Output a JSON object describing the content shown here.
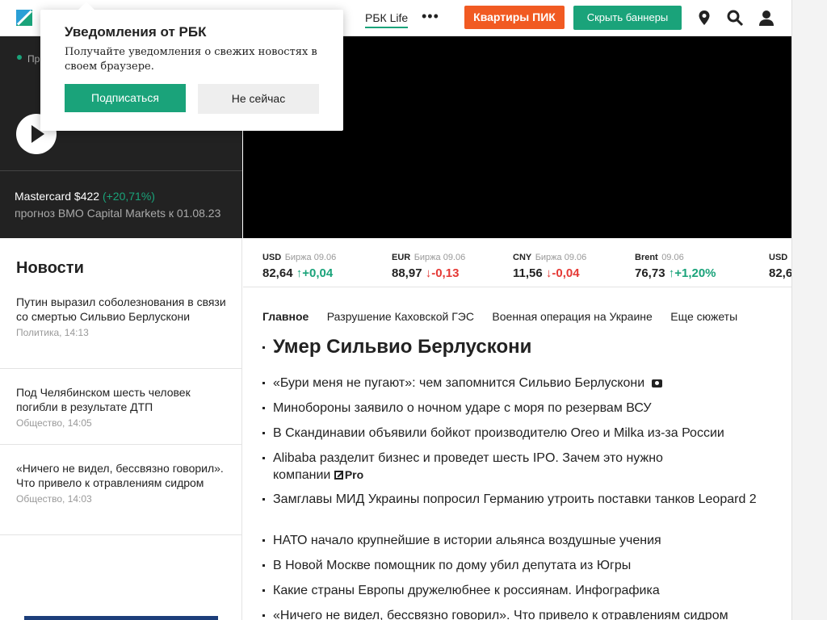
{
  "header": {
    "nav_partial": "и",
    "nav_life": "РБК Life",
    "nav_more": "•••",
    "pik_button": "Квартиры ПИК",
    "hide_banners_button": "Скрыть баннеры"
  },
  "icons": [
    "location-pin-icon",
    "search-icon",
    "user-icon",
    "camera-icon",
    "play-icon"
  ],
  "colors": {
    "accent_green": "#1aa37a",
    "pik_orange": "#f15a22",
    "down_red": "#e53935"
  },
  "promo": {
    "label": "Пр",
    "title": "Mastercard $422",
    "gain": "(+20,71%)",
    "subtitle": "прогноз BMO Capital Markets к 01.08.23"
  },
  "ticker": [
    {
      "cur": "USD",
      "src": "Биржа 09.06",
      "value": "82,64",
      "arrow": "↑",
      "change": "+0,04",
      "dir": "up"
    },
    {
      "cur": "EUR",
      "src": "Биржа 09.06",
      "value": "88,97",
      "arrow": "↓",
      "change": "-0,13",
      "dir": "down"
    },
    {
      "cur": "CNY",
      "src": "Биржа 09.06",
      "value": "11,56",
      "arrow": "↓",
      "change": "-0,04",
      "dir": "down"
    },
    {
      "cur": "Brent",
      "src": "09.06",
      "value": "76,73",
      "arrow": "↑",
      "change": "+1,20%",
      "dir": "up"
    },
    {
      "cur": "USD",
      "src": "",
      "value": "82,6",
      "arrow": "",
      "change": "",
      "dir": "up"
    }
  ],
  "news": {
    "heading": "Новости",
    "items": [
      {
        "title": "Путин выразил соболезнования в связи со смертью Сильвио Берлускони",
        "meta": "Политика, 14:13"
      },
      {
        "title": "Под Челябинском шесть человек погибли в результате ДТП",
        "meta": "Общество, 14:05"
      },
      {
        "title": "«Ничего не видел, бессвязно говорил». Что привело к отравлениям сидром",
        "meta": "Общество, 14:03"
      }
    ]
  },
  "tabs": [
    "Главное",
    "Разрушение Каховской ГЭС",
    "Военная операция на Украине",
    "Еще сюжеты"
  ],
  "headline": "Умер Сильвио Берлускони",
  "feed": [
    {
      "text": "«Бури меня не пугают»: чем запомнится Сильвио Берлускони"
    },
    {
      "text": "Минобороны заявило о ночном ударе с моря по резервам ВСУ"
    },
    {
      "text": "В Скандинавии объявили бойкот производителю Oreo и Milka из-за России"
    },
    {
      "text": "Alibaba разделит бизнес и проведет шесть IPO. Зачем это нужно компании",
      "badge": "Pro"
    },
    {
      "text": "Замглавы МИД Украины попросил Германию утроить поставки танков Leopard 2"
    },
    {
      "text": "НАТО начало крупнейшие в истории альянса воздушные учения"
    },
    {
      "text": "В Новой Москве помощник по дому убил депутата из Югры"
    },
    {
      "text": "Какие страны Европы дружелюбнее к россиянам. Инфографика"
    },
    {
      "text": "«Ничего не видел, бессвязно говорил». Что привело к отравлениям сидром"
    }
  ],
  "popup": {
    "title": "Уведомления от РБК",
    "body": "Получайте уведомления о свежих новостях в своем браузере.",
    "subscribe": "Подписаться",
    "not_now": "Не сейчас"
  }
}
